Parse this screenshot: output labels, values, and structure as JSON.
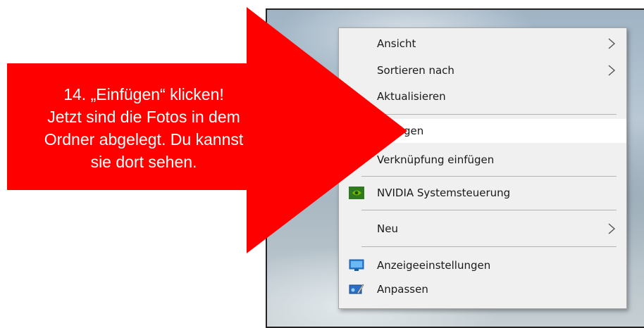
{
  "callout": {
    "lines": [
      "14. „Einfügen“ klicken!",
      "Jetzt sind die Fotos in dem",
      "Ordner abgelegt. Du kannst",
      "sie dort sehen."
    ],
    "color": "#ff0000"
  },
  "context_menu": {
    "items": [
      {
        "label": "Ansicht",
        "submenu": true
      },
      {
        "label": "Sortieren nach",
        "submenu": true
      },
      {
        "label": "Aktualisieren",
        "submenu": false
      },
      {
        "label": "Einfügen",
        "submenu": false,
        "highlighted": true
      },
      {
        "label": "Verknüpfung einfügen",
        "submenu": false
      },
      {
        "label": "NVIDIA Systemsteuerung",
        "icon": "nvidia-icon"
      },
      {
        "label": "Neu",
        "submenu": true
      },
      {
        "label": "Anzeigeeinstellungen",
        "icon": "display-settings-icon"
      },
      {
        "label": "Anpassen",
        "icon": "personalize-icon"
      }
    ]
  }
}
